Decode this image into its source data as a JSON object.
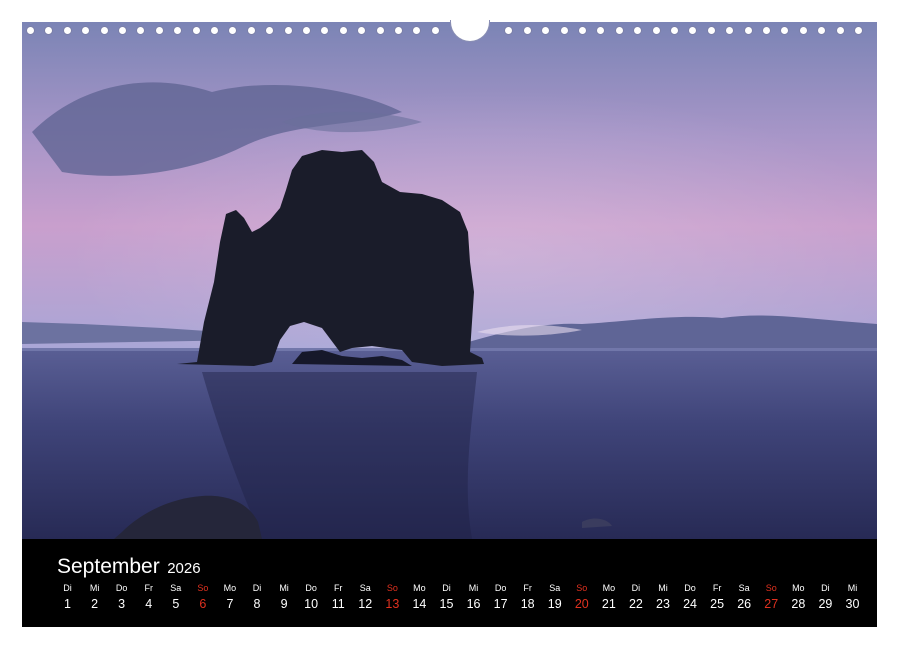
{
  "calendar": {
    "month": "September",
    "year": "2026",
    "days": [
      {
        "weekday": "Di",
        "day": "1",
        "sunday": false
      },
      {
        "weekday": "Mi",
        "day": "2",
        "sunday": false
      },
      {
        "weekday": "Do",
        "day": "3",
        "sunday": false
      },
      {
        "weekday": "Fr",
        "day": "4",
        "sunday": false
      },
      {
        "weekday": "Sa",
        "day": "5",
        "sunday": false
      },
      {
        "weekday": "So",
        "day": "6",
        "sunday": true
      },
      {
        "weekday": "Mo",
        "day": "7",
        "sunday": false
      },
      {
        "weekday": "Di",
        "day": "8",
        "sunday": false
      },
      {
        "weekday": "Mi",
        "day": "9",
        "sunday": false
      },
      {
        "weekday": "Do",
        "day": "10",
        "sunday": false
      },
      {
        "weekday": "Fr",
        "day": "11",
        "sunday": false
      },
      {
        "weekday": "Sa",
        "day": "12",
        "sunday": false
      },
      {
        "weekday": "So",
        "day": "13",
        "sunday": true
      },
      {
        "weekday": "Mo",
        "day": "14",
        "sunday": false
      },
      {
        "weekday": "Di",
        "day": "15",
        "sunday": false
      },
      {
        "weekday": "Mi",
        "day": "16",
        "sunday": false
      },
      {
        "weekday": "Do",
        "day": "17",
        "sunday": false
      },
      {
        "weekday": "Fr",
        "day": "18",
        "sunday": false
      },
      {
        "weekday": "Sa",
        "day": "19",
        "sunday": false
      },
      {
        "weekday": "So",
        "day": "20",
        "sunday": true
      },
      {
        "weekday": "Mo",
        "day": "21",
        "sunday": false
      },
      {
        "weekday": "Di",
        "day": "22",
        "sunday": false
      },
      {
        "weekday": "Mi",
        "day": "23",
        "sunday": false
      },
      {
        "weekday": "Do",
        "day": "24",
        "sunday": false
      },
      {
        "weekday": "Fr",
        "day": "25",
        "sunday": false
      },
      {
        "weekday": "Sa",
        "day": "26",
        "sunday": false
      },
      {
        "weekday": "So",
        "day": "27",
        "sunday": true
      },
      {
        "weekday": "Mo",
        "day": "28",
        "sunday": false
      },
      {
        "weekday": "Di",
        "day": "29",
        "sunday": false
      },
      {
        "weekday": "Mi",
        "day": "30",
        "sunday": false
      }
    ]
  },
  "colors": {
    "calendar_background": "#000000",
    "text": "#ffffff",
    "sunday": "#e0311f",
    "sky_top": "#7d86b6",
    "sky_bottom": "#cfa0cc",
    "water": "#3b3f72"
  }
}
